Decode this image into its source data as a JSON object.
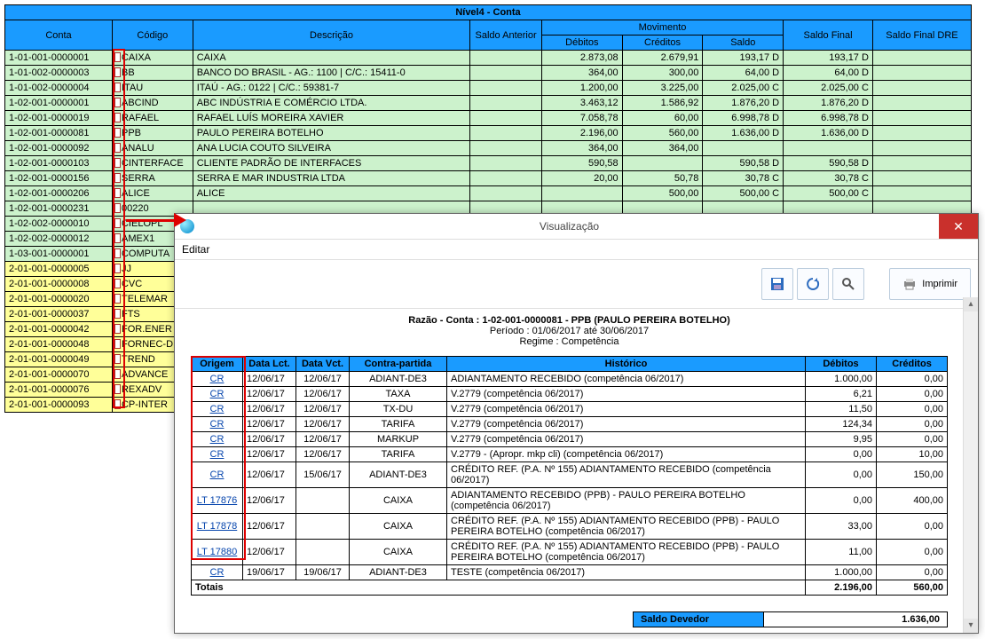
{
  "main_table": {
    "title": "Nível4 - Conta",
    "headers": {
      "conta": "Conta",
      "codigo": "Código",
      "descricao": "Descrição",
      "saldo_ant": "Saldo Anterior",
      "movimento": "Movimento",
      "debitos": "Débitos",
      "creditos": "Créditos",
      "saldo": "Saldo",
      "saldo_final": "Saldo Final",
      "saldo_dre": "Saldo Final DRE"
    },
    "rows": [
      {
        "cls": "g",
        "conta": "1-01-001-0000001",
        "codigo": "CAIXA",
        "desc": "CAIXA",
        "sa": "",
        "deb": "2.873,08",
        "cred": "2.679,91",
        "saldo": "193,17 D",
        "sf": "193,17 D",
        "dre": ""
      },
      {
        "cls": "g",
        "conta": "1-01-002-0000003",
        "codigo": "BB",
        "desc": "BANCO DO BRASIL - AG.: 1100 | C/C.: 15411-0",
        "sa": "",
        "deb": "364,00",
        "cred": "300,00",
        "saldo": "64,00 D",
        "sf": "64,00 D",
        "dre": ""
      },
      {
        "cls": "g",
        "conta": "1-01-002-0000004",
        "codigo": "ITAU",
        "desc": "ITAÚ - AG.: 0122 | C/C.: 59381-7",
        "sa": "",
        "deb": "1.200,00",
        "cred": "3.225,00",
        "saldo": "2.025,00 C",
        "sf": "2.025,00 C",
        "dre": ""
      },
      {
        "cls": "g",
        "conta": "1-02-001-0000001",
        "codigo": "ABCIND",
        "desc": "ABC INDÚSTRIA E COMÉRCIO LTDA.",
        "sa": "",
        "deb": "3.463,12",
        "cred": "1.586,92",
        "saldo": "1.876,20 D",
        "sf": "1.876,20 D",
        "dre": ""
      },
      {
        "cls": "g",
        "conta": "1-02-001-0000019",
        "codigo": "RAFAEL",
        "desc": "RAFAEL LUÍS MOREIRA XAVIER",
        "sa": "",
        "deb": "7.058,78",
        "cred": "60,00",
        "saldo": "6.998,78 D",
        "sf": "6.998,78 D",
        "dre": ""
      },
      {
        "cls": "g",
        "conta": "1-02-001-0000081",
        "codigo": "PPB",
        "desc": "PAULO PEREIRA BOTELHO",
        "sa": "",
        "deb": "2.196,00",
        "cred": "560,00",
        "saldo": "1.636,00 D",
        "sf": "1.636,00 D",
        "dre": ""
      },
      {
        "cls": "g",
        "conta": "1-02-001-0000092",
        "codigo": "ANALU",
        "desc": "ANA LUCIA COUTO SILVEIRA",
        "sa": "",
        "deb": "364,00",
        "cred": "364,00",
        "saldo": "",
        "sf": "",
        "dre": ""
      },
      {
        "cls": "g",
        "conta": "1-02-001-0000103",
        "codigo": "CINTERFACE",
        "desc": "CLIENTE PADRÃO DE INTERFACES",
        "sa": "",
        "deb": "590,58",
        "cred": "",
        "saldo": "590,58 D",
        "sf": "590,58 D",
        "dre": ""
      },
      {
        "cls": "g",
        "conta": "1-02-001-0000156",
        "codigo": "SERRA",
        "desc": "SERRA E MAR INDUSTRIA LTDA",
        "sa": "",
        "deb": "20,00",
        "cred": "50,78",
        "saldo": "30,78 C",
        "sf": "30,78 C",
        "dre": ""
      },
      {
        "cls": "g",
        "conta": "1-02-001-0000206",
        "codigo": "ALICE",
        "desc": "ALICE",
        "sa": "",
        "deb": "",
        "cred": "500,00",
        "saldo": "500,00 C",
        "sf": "500,00 C",
        "dre": ""
      },
      {
        "cls": "g",
        "conta": "1-02-001-0000231",
        "codigo": "00220",
        "desc": "",
        "sa": "",
        "deb": "",
        "cred": "",
        "saldo": "",
        "sf": "",
        "dre": ""
      },
      {
        "cls": "g",
        "conta": "1-02-002-0000010",
        "codigo": "CIELOPL",
        "desc": "",
        "sa": "",
        "deb": "",
        "cred": "",
        "saldo": "",
        "sf": "",
        "dre": ""
      },
      {
        "cls": "g",
        "conta": "1-02-002-0000012",
        "codigo": "AMEX1",
        "desc": "",
        "sa": "",
        "deb": "",
        "cred": "",
        "saldo": "",
        "sf": "",
        "dre": ""
      },
      {
        "cls": "g",
        "conta": "1-03-001-0000001",
        "codigo": "COMPUTA",
        "desc": "",
        "sa": "",
        "deb": "",
        "cred": "",
        "saldo": "",
        "sf": "",
        "dre": ""
      },
      {
        "cls": "y",
        "conta": "2-01-001-0000005",
        "codigo": "JJ",
        "desc": "",
        "sa": "",
        "deb": "",
        "cred": "",
        "saldo": "",
        "sf": "",
        "dre": ""
      },
      {
        "cls": "y",
        "conta": "2-01-001-0000008",
        "codigo": "CVC",
        "desc": "",
        "sa": "",
        "deb": "",
        "cred": "",
        "saldo": "",
        "sf": "",
        "dre": ""
      },
      {
        "cls": "y",
        "conta": "2-01-001-0000020",
        "codigo": "TELEMAR",
        "desc": "",
        "sa": "",
        "deb": "",
        "cred": "",
        "saldo": "",
        "sf": "",
        "dre": ""
      },
      {
        "cls": "y",
        "conta": "2-01-001-0000037",
        "codigo": "FTS",
        "desc": "",
        "sa": "",
        "deb": "",
        "cred": "",
        "saldo": "",
        "sf": "",
        "dre": ""
      },
      {
        "cls": "y",
        "conta": "2-01-001-0000042",
        "codigo": "FOR.ENER",
        "desc": "",
        "sa": "",
        "deb": "",
        "cred": "",
        "saldo": "",
        "sf": "",
        "dre": ""
      },
      {
        "cls": "y",
        "conta": "2-01-001-0000048",
        "codigo": "FORNEC-D",
        "desc": "",
        "sa": "",
        "deb": "",
        "cred": "",
        "saldo": "",
        "sf": "",
        "dre": ""
      },
      {
        "cls": "y",
        "conta": "2-01-001-0000049",
        "codigo": "TREND",
        "desc": "",
        "sa": "",
        "deb": "",
        "cred": "",
        "saldo": "",
        "sf": "",
        "dre": ""
      },
      {
        "cls": "y",
        "conta": "2-01-001-0000070",
        "codigo": "ADVANCE",
        "desc": "",
        "sa": "",
        "deb": "",
        "cred": "",
        "saldo": "",
        "sf": "",
        "dre": ""
      },
      {
        "cls": "y",
        "conta": "2-01-001-0000076",
        "codigo": "REXADV",
        "desc": "",
        "sa": "",
        "deb": "",
        "cred": "",
        "saldo": "",
        "sf": "",
        "dre": ""
      },
      {
        "cls": "y",
        "conta": "2-01-001-0000093",
        "codigo": "CP-INTER",
        "desc": "",
        "sa": "",
        "deb": "",
        "cred": "",
        "saldo": "",
        "sf": "",
        "dre": ""
      }
    ]
  },
  "dialog": {
    "title": "Visualização",
    "close": "✕",
    "menu_edit": "Editar",
    "print_btn": "Imprimir",
    "report": {
      "line1a": "Razão - Conta : 1-02-001-0000081 - PPB (PAULO PEREIRA BOTELHO)",
      "line2": "Período : 01/06/2017 até 30/06/2017",
      "line3": "Regime : Competência",
      "headers": {
        "origem": "Origem",
        "data_lct": "Data Lct.",
        "data_vct": "Data Vct.",
        "contra": "Contra-partida",
        "hist": "Histórico",
        "deb": "Débitos",
        "cred": "Créditos"
      },
      "rows": [
        {
          "o": "CR",
          "dl": "12/06/17",
          "dv": "12/06/17",
          "c": "ADIANT-DE3",
          "h": "ADIANTAMENTO RECEBIDO (competência 06/2017)",
          "d": "1.000,00",
          "cr": "0,00"
        },
        {
          "o": "CR",
          "dl": "12/06/17",
          "dv": "12/06/17",
          "c": "TAXA",
          "h": "V.2779 (competência 06/2017)",
          "d": "6,21",
          "cr": "0,00"
        },
        {
          "o": "CR",
          "dl": "12/06/17",
          "dv": "12/06/17",
          "c": "TX-DU",
          "h": "V.2779 (competência 06/2017)",
          "d": "11,50",
          "cr": "0,00"
        },
        {
          "o": "CR",
          "dl": "12/06/17",
          "dv": "12/06/17",
          "c": "TARIFA",
          "h": "V.2779 (competência 06/2017)",
          "d": "124,34",
          "cr": "0,00"
        },
        {
          "o": "CR",
          "dl": "12/06/17",
          "dv": "12/06/17",
          "c": "MARKUP",
          "h": "V.2779 (competência 06/2017)",
          "d": "9,95",
          "cr": "0,00"
        },
        {
          "o": "CR",
          "dl": "12/06/17",
          "dv": "12/06/17",
          "c": "TARIFA",
          "h": "V.2779 - (Apropr. mkp cli) (competência 06/2017)",
          "d": "0,00",
          "cr": "10,00"
        },
        {
          "o": "CR",
          "dl": "12/06/17",
          "dv": "15/06/17",
          "c": "ADIANT-DE3",
          "h": "CRÉDITO REF. (P.A. Nº 155) ADIANTAMENTO RECEBIDO (competência 06/2017)",
          "d": "0,00",
          "cr": "150,00"
        },
        {
          "o": "LT 17876",
          "dl": "12/06/17",
          "dv": "",
          "c": "CAIXA",
          "h": "ADIANTAMENTO RECEBIDO (PPB) - PAULO PEREIRA BOTELHO (competência 06/2017)",
          "d": "0,00",
          "cr": "400,00"
        },
        {
          "o": "LT 17878",
          "dl": "12/06/17",
          "dv": "",
          "c": "CAIXA",
          "h": "CRÉDITO REF. (P.A. Nº 155) ADIANTAMENTO RECEBIDO (PPB) - PAULO PEREIRA BOTELHO (competência 06/2017)",
          "d": "33,00",
          "cr": "0,00"
        },
        {
          "o": "LT 17880",
          "dl": "12/06/17",
          "dv": "",
          "c": "CAIXA",
          "h": "CRÉDITO REF. (P.A. Nº 155) ADIANTAMENTO RECEBIDO (PPB) - PAULO PEREIRA BOTELHO (competência 06/2017)",
          "d": "11,00",
          "cr": "0,00"
        },
        {
          "o": "CR",
          "dl": "19/06/17",
          "dv": "19/06/17",
          "c": "ADIANT-DE3",
          "h": "TESTE (competência 06/2017)",
          "d": "1.000,00",
          "cr": "0,00"
        }
      ],
      "totals_label": "Totais",
      "totals_deb": "2.196,00",
      "totals_cred": "560,00",
      "saldo_dev_label": "Saldo Devedor",
      "saldo_dev": "1.636,00"
    }
  }
}
